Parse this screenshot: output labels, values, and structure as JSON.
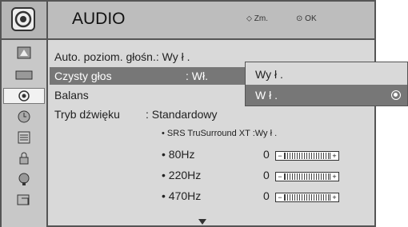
{
  "header": {
    "title": "AUDIO",
    "hint_move": "Zm.",
    "hint_ok": "OK"
  },
  "sidebar": {
    "items": [
      {
        "icon": "picture-icon"
      },
      {
        "icon": "screen-icon"
      },
      {
        "icon": "audio-icon",
        "active": true
      },
      {
        "icon": "time-icon"
      },
      {
        "icon": "option-icon"
      },
      {
        "icon": "lock-icon"
      },
      {
        "icon": "input-icon"
      },
      {
        "icon": "usb-icon"
      }
    ]
  },
  "menu": {
    "auto_volume": "Auto. poziom. głośn.: Wy ł .",
    "clear_voice": "Czysty głos",
    "clear_voice_value": ": Wł.",
    "balance": "Balans",
    "sound_mode_label": "Tryb dźwięku",
    "sound_mode_value": ": Standardowy",
    "srs": "• SRS TruSurround XT :Wy ł .",
    "eq": [
      {
        "label": "• 80Hz",
        "value": "0"
      },
      {
        "label": "• 220Hz",
        "value": "0"
      },
      {
        "label": "• 470Hz",
        "value": "0"
      }
    ]
  },
  "popup": {
    "options": [
      "Wy ł .",
      "W ł ."
    ],
    "selected_index": 1
  },
  "colors": {
    "selected_bg": "#777777",
    "panel_bg": "#d9d9d9",
    "header_bg": "#bdbdbd"
  }
}
